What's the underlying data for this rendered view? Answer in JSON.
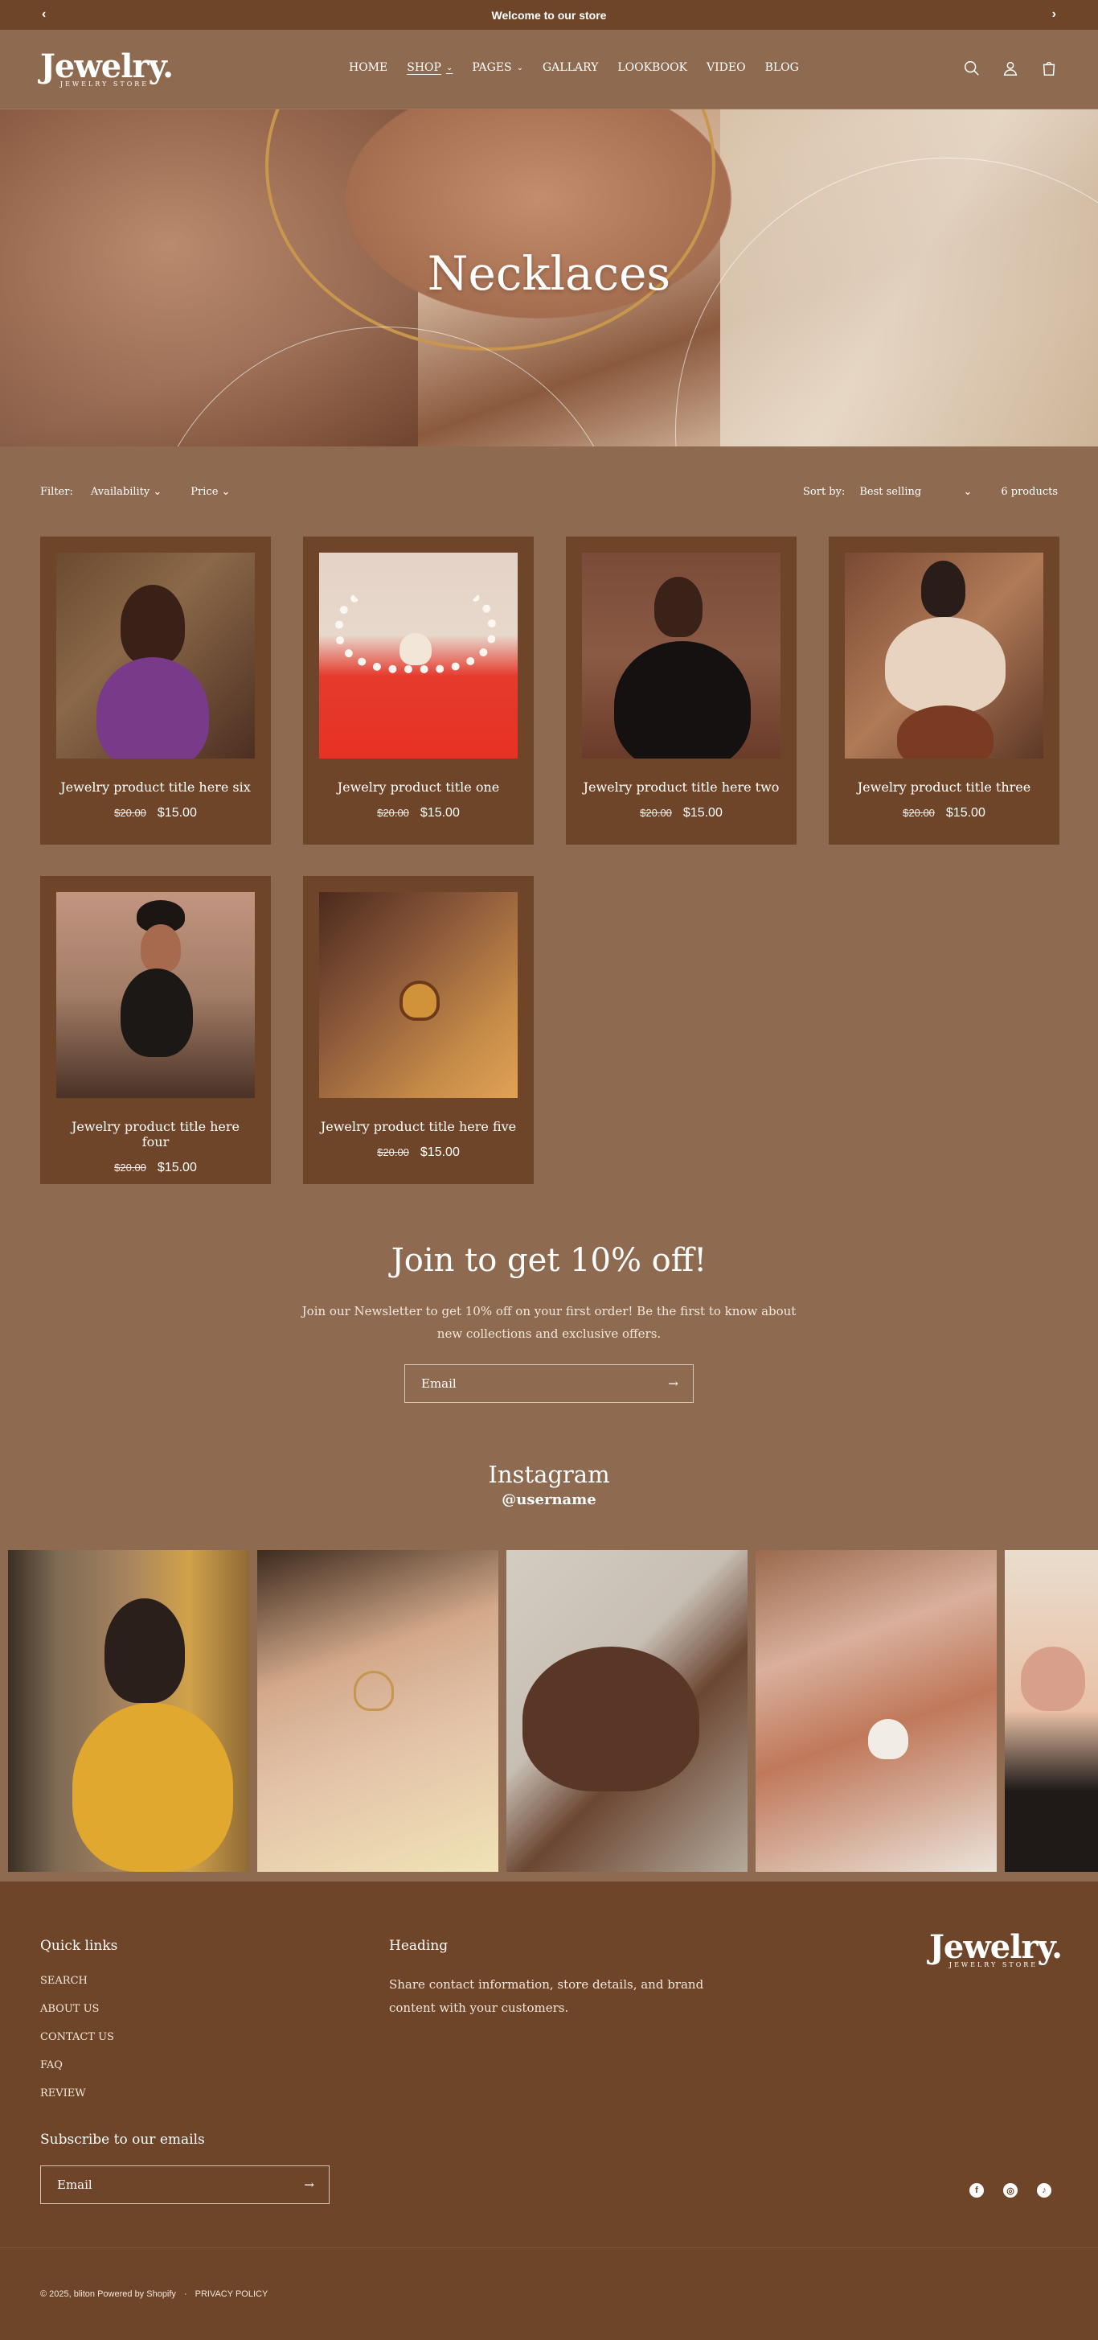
{
  "announcement": {
    "text": "Welcome to our store"
  },
  "logo": {
    "name": "Jewelry.",
    "tagline": "JEWELRY STORE"
  },
  "nav": {
    "items": [
      {
        "label": "HOME"
      },
      {
        "label": "SHOP",
        "dropdown": true,
        "active": true
      },
      {
        "label": "PAGES",
        "dropdown": true
      },
      {
        "label": "GALLARY"
      },
      {
        "label": "LOOKBOOK"
      },
      {
        "label": "VIDEO"
      },
      {
        "label": "BLOG"
      }
    ]
  },
  "hero": {
    "title": "Necklaces"
  },
  "filters": {
    "label": "Filter:",
    "availability": "Availability",
    "price": "Price",
    "sort_label": "Sort by:",
    "sort_value": "Best selling",
    "count": "6 products"
  },
  "products": [
    {
      "title": "Jewelry product title here six",
      "old_price": "$20.00",
      "price": "$15.00"
    },
    {
      "title": "Jewelry product title one",
      "old_price": "$20.00",
      "price": "$15.00"
    },
    {
      "title": "Jewelry product title here two",
      "old_price": "$20.00",
      "price": "$15.00"
    },
    {
      "title": "Jewelry product title three",
      "old_price": "$20.00",
      "price": "$15.00"
    },
    {
      "title": "Jewelry product title here four",
      "old_price": "$20.00",
      "price": "$15.00"
    },
    {
      "title": "Jewelry product title here five",
      "old_price": "$20.00",
      "price": "$15.00"
    }
  ],
  "newsletter": {
    "title": "Join to get 10% off!",
    "text": "Join our Newsletter to get 10% off on your first order! Be the first to know about new collections and exclusive offers.",
    "placeholder": "Email"
  },
  "instagram": {
    "title": "Instagram",
    "username": "@username"
  },
  "footer": {
    "quick_links_title": "Quick links",
    "links": [
      "SEARCH",
      "ABOUT US",
      "CONTACT US",
      "FAQ",
      "REVIEW"
    ],
    "heading": "Heading",
    "heading_text": "Share contact information, store details, and brand content with your customers.",
    "subscribe_title": "Subscribe to our emails",
    "email_placeholder": "Email",
    "copyright": "© 2025, bliton Powered by Shopify",
    "separator": "·",
    "privacy": "PRIVACY POLICY"
  },
  "colors": {
    "background": "#8e6a50",
    "dark": "#6f4529"
  }
}
